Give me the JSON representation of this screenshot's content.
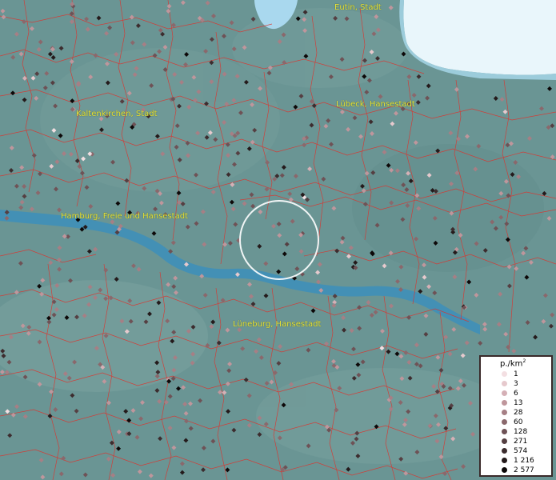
{
  "colors": {
    "land": "#6a9594",
    "water": "#3f8fb8",
    "sea": "#e9f6fb",
    "border": "#e0302a",
    "label": "#e8e23a"
  },
  "places": [
    {
      "name": "Eutin, Stadt"
    },
    {
      "name": "Kaltenkirchen, Stadt"
    },
    {
      "name": "Lübeck, Hansestadt"
    },
    {
      "name": "Hamburg, Freie und Hansestadt"
    },
    {
      "name": "Lüneburg, Hansestadt"
    }
  ],
  "legend": {
    "title": "p./km",
    "title_sup": "2",
    "items": [
      {
        "label": "1",
        "color": "#f3dfe2"
      },
      {
        "label": "3",
        "color": "#e6c9cd"
      },
      {
        "label": "6",
        "color": "#d5b0b6"
      },
      {
        "label": "13",
        "color": "#bf969c"
      },
      {
        "label": "28",
        "color": "#a67f85"
      },
      {
        "label": "60",
        "color": "#8a686c"
      },
      {
        "label": "128",
        "color": "#6e5256"
      },
      {
        "label": "271",
        "color": "#553f42"
      },
      {
        "label": "574",
        "color": "#3c2c2e"
      },
      {
        "label": "1 216",
        "color": "#241a1b"
      },
      {
        "label": "2 577",
        "color": "#0d0808"
      }
    ]
  }
}
